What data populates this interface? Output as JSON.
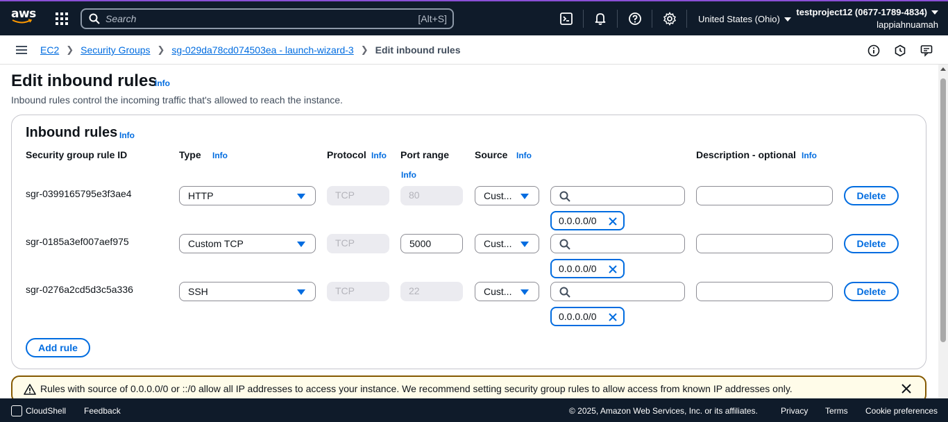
{
  "topnav": {
    "logo_text": "aws",
    "search_placeholder": "Search",
    "search_shortcut": "[Alt+S]",
    "region": "United States (Ohio)",
    "account": "testproject12 (0677-1789-4834)",
    "username": "lappiahnuamah",
    "icons": [
      "cloudshell-icon",
      "bell-icon",
      "help-icon",
      "settings-icon"
    ]
  },
  "breadcrumb": {
    "items": [
      "EC2",
      "Security Groups",
      "sg-029da78cd074503ea - launch-wizard-3"
    ],
    "current": "Edit inbound rules"
  },
  "page": {
    "title": "Edit inbound rules",
    "info": "Info",
    "description": "Inbound rules control the incoming traffic that's allowed to reach the instance."
  },
  "card": {
    "title": "Inbound rules",
    "info": "Info",
    "columns": {
      "rule_id": "Security group rule ID",
      "type": "Type",
      "protocol": "Protocol",
      "port_range": "Port range",
      "source": "Source",
      "description": "Description - optional"
    },
    "rules": [
      {
        "id": "sgr-0399165795e3f3ae4",
        "type": "HTTP",
        "protocol": "TCP",
        "port": "80",
        "source": "Cust...",
        "cidr": "0.0.0.0/0",
        "delete": "Delete"
      },
      {
        "id": "sgr-0185a3ef007aef975",
        "type": "Custom TCP",
        "protocol": "TCP",
        "port": "5000",
        "source": "Cust...",
        "cidr": "0.0.0.0/0",
        "delete": "Delete"
      },
      {
        "id": "sgr-0276a2cd5d3c5a336",
        "type": "SSH",
        "protocol": "TCP",
        "port": "22",
        "source": "Cust...",
        "cidr": "0.0.0.0/0",
        "delete": "Delete"
      }
    ],
    "add_rule": "Add rule"
  },
  "warning": {
    "text": "Rules with source of 0.0.0.0/0 or ::/0 allow all IP addresses to access your instance. We recommend setting security group rules to allow access from known IP addresses only."
  },
  "footer": {
    "cloudshell": "CloudShell",
    "feedback": "Feedback",
    "copyright": "© 2025, Amazon Web Services, Inc. or its affiliates.",
    "privacy": "Privacy",
    "terms": "Terms",
    "cookies": "Cookie preferences"
  },
  "colors": {
    "nav_bg": "#0f1b2a",
    "link": "#006ce0",
    "warning_border": "#855900",
    "warning_bg": "#fffce9"
  }
}
